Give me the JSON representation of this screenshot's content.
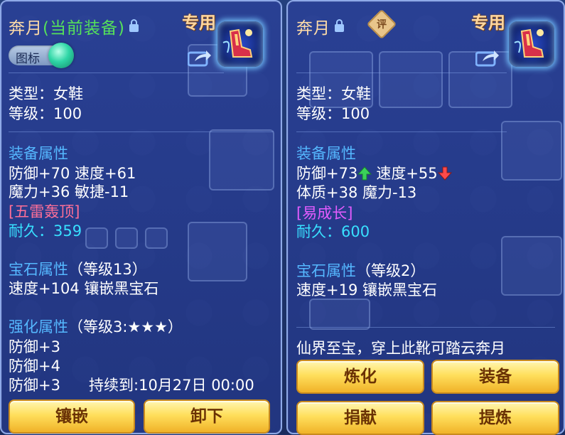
{
  "left_panel": {
    "title": {
      "name": "奔月",
      "equipped_tag": "(当前装备)"
    },
    "exclusive": "专用",
    "toggle_label": "图标",
    "type_line": "类型：女鞋",
    "level_line": "等级：100",
    "equip_attr_header": "装备属性",
    "attr_lines": [
      "防御+70 速度+61",
      "魔力+36 敏捷-11"
    ],
    "special_skill": "[五雷轰顶]",
    "durability": "耐久：359",
    "gem_header": "宝石属性",
    "gem_level": "（等级13）",
    "gem_line": "速度+104 镶嵌黑宝石",
    "enhance_header": "强化属性",
    "enhance_level": "（等级3:★★★）",
    "enhance_lines": [
      "防御+3",
      "防御+4",
      "防御+3      持续到:10月27日 00:00"
    ],
    "buttons": {
      "inlay": "镶嵌",
      "unequip": "卸下"
    }
  },
  "right_panel": {
    "title": {
      "name": "奔月"
    },
    "rating_badge": "评",
    "exclusive": "专用",
    "type_line": "类型：女鞋",
    "level_line": "等级：100",
    "equip_attr_header": "装备属性",
    "attr_line1": {
      "a": "防御+73",
      "b": "速度+55"
    },
    "attr_line2": "体质+38 魔力-13",
    "special_skill": "[易成长]",
    "durability": "耐久：600",
    "gem_header": "宝石属性",
    "gem_level": "（等级2）",
    "gem_line": "速度+19 镶嵌黑宝石",
    "description": "仙界至宝，穿上此靴可踏云奔月",
    "buttons": {
      "refine": "炼化",
      "equip": "装备",
      "donate": "捐献",
      "extract": "提炼"
    }
  },
  "colors": {
    "panel_bg": "#2a4096",
    "section_blue": "#55b8ff",
    "equipped_green": "#55e15a",
    "skill_pink": "#ff6f98",
    "skill_purple": "#e45cff",
    "durability_cyan": "#38e0ff",
    "button_gold": "#ffdf5c"
  },
  "icons": [
    "lock-icon",
    "rating-badge-icon",
    "share-icon",
    "boots-item-icon",
    "toggle-knob-icon",
    "arrow-up-icon",
    "arrow-down-icon"
  ]
}
